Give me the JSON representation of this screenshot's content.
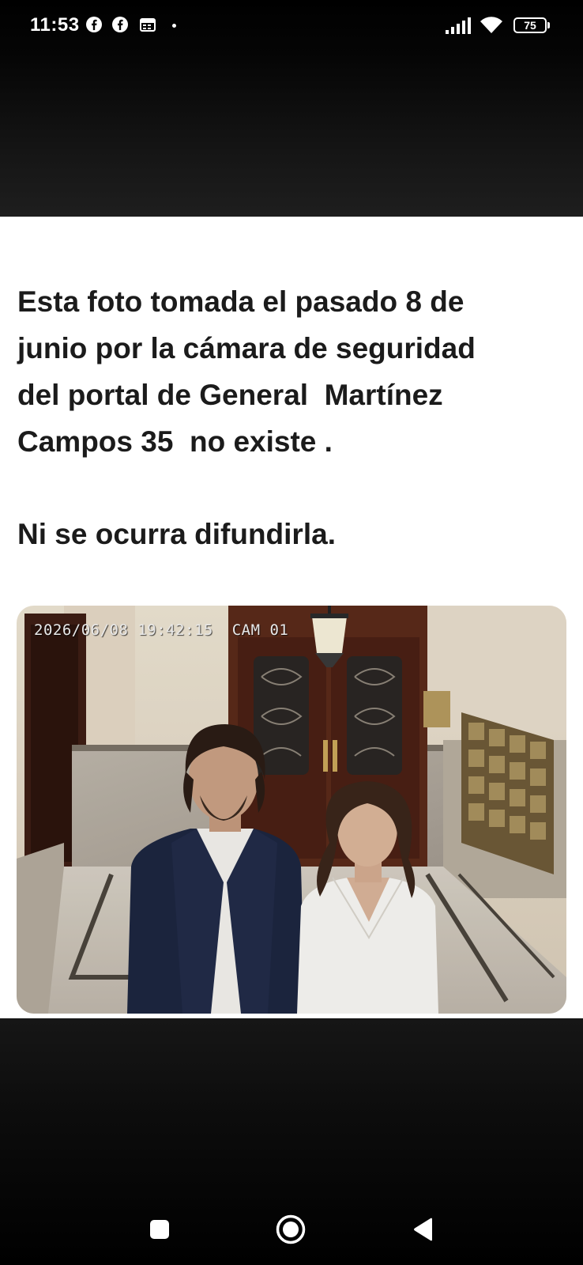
{
  "status_bar": {
    "time": "11:53",
    "battery": "75",
    "icons": [
      "facebook-icon",
      "facebook-icon",
      "calendar-icon",
      "signal-icon",
      "wifi-icon",
      "battery-icon"
    ]
  },
  "post": {
    "paragraph1_lines": [
      "Esta foto tomada el pasado 8 de",
      "junio por la cámara de seguridad",
      "del portal de General  Martínez",
      "Campos 35  no existe ."
    ],
    "paragraph2": "Ni se ocurra difundirla.",
    "photo": {
      "timestamp": "2026/06/08 19:42:15",
      "camera": "CAM 01"
    }
  },
  "nav_bar": {
    "buttons": [
      "recents-button",
      "home-button",
      "back-button"
    ]
  }
}
